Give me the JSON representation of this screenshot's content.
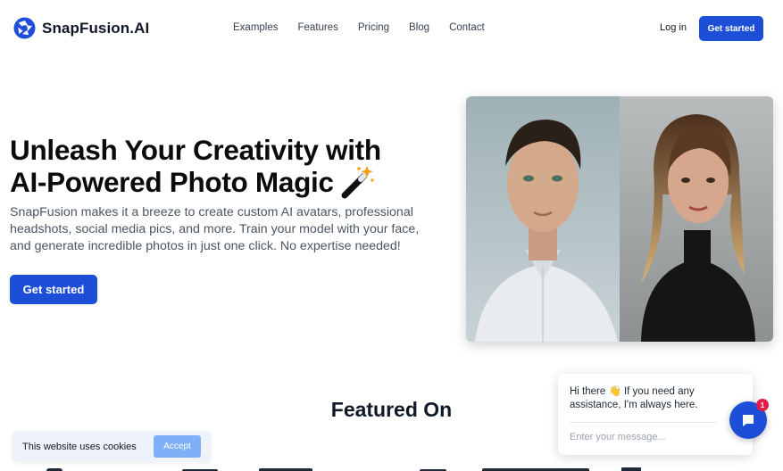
{
  "brand": {
    "name": "SnapFusion.AI",
    "logo_icon": "aperture-icon",
    "accent": "#1d4ed8"
  },
  "nav": {
    "links": [
      "Examples",
      "Features",
      "Pricing",
      "Blog",
      "Contact"
    ],
    "login": "Log in",
    "cta": "Get started"
  },
  "hero": {
    "title_line1": "Unleash Your Creativity with",
    "title_line2": "AI-Powered Photo Magic",
    "title_icon": "magic-wand-icon",
    "description": "SnapFusion makes it a breeze to create custom AI avatars, professional headshots, social media pics, and more. Train your model with your face, and generate incredible photos in just one click. No expertise needed!",
    "cta": "Get started",
    "image": "portrait-comparison-image"
  },
  "featured": {
    "title": "Featured On"
  },
  "cookie": {
    "text": "This website uses cookies",
    "accept": "Accept"
  },
  "chat": {
    "greeting": "Hi there 👋 If you need any assistance, I'm always here.",
    "placeholder": "Enter your message...",
    "badge": "1",
    "icon": "chat-icon"
  }
}
